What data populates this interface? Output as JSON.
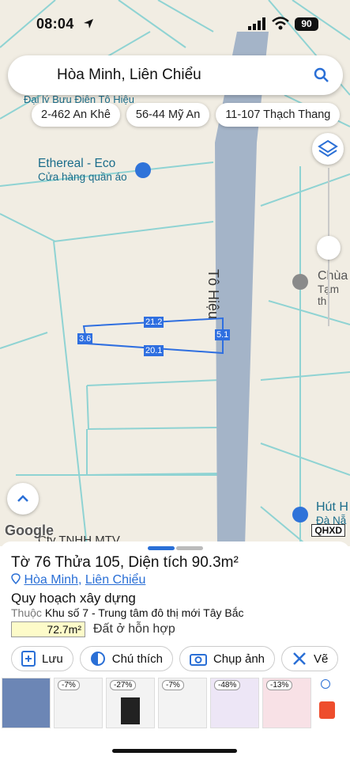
{
  "status_bar": {
    "time": "08:04",
    "battery": "90"
  },
  "search": {
    "query": "Hòa Minh, Liên Chiểu"
  },
  "chips": [
    "2-462 An Khê",
    "56-44 Mỹ An",
    "11-107 Thạch Thang"
  ],
  "map": {
    "poi_shop_name": "Ethereal - Eco",
    "poi_shop_type": "Cửa hàng quần áo",
    "poi_temple_name": "Chùa",
    "poi_temple_sub": "Tạm th",
    "poi_hut_name": "Hút H",
    "poi_hut_sub": "Đà Nẵ",
    "poi_company": "Cty TNHH MTV",
    "poi_top_text": "Đại lý Bưu Điện Tô Hiệu",
    "road_name": "Tô Hiệu",
    "dimensions": {
      "top": "21.2",
      "bottom": "20.1",
      "left": "3.6",
      "right": "5.1"
    },
    "google_logo": "Google",
    "qhxd": "QHXD"
  },
  "sheet": {
    "title": "Tờ 76 Thửa 105, Diện tích 90.3m²",
    "ward": "Hòa Minh",
    "district": "Liên Chiểu",
    "separator": ",",
    "plan_heading": "Quy hoạch xây dựng",
    "zone_label": "Thuộc",
    "zone_value": "Khu số 7 - Trung tâm đô thị mới Tây Bắc",
    "area": "72.7m²",
    "land_use": "Đất ở hỗn hợp",
    "actions": {
      "save": "Lưu",
      "legend": "Chú thích",
      "capture": "Chụp ảnh",
      "draw": "Vẽ"
    }
  },
  "ads": {
    "discounts": [
      "-7%",
      "-27%",
      "-7%",
      "-48%",
      "-13%"
    ]
  },
  "colors": {
    "plot_line": "#2f6fe0",
    "road": "#a4b4c8",
    "parcel_line": "#8fd3d3"
  }
}
